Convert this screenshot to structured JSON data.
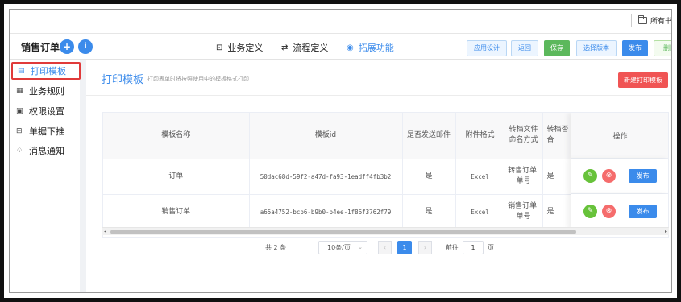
{
  "browser": {
    "bookmark_folder": "所有书签"
  },
  "header": {
    "app_title": "销售订单",
    "plus_icon": "+",
    "info_icon": "i",
    "tabs": [
      {
        "label": "业务定义",
        "icon": "form-icon"
      },
      {
        "label": "流程定义",
        "icon": "flow-icon"
      },
      {
        "label": "拓展功能",
        "icon": "extension-icon"
      }
    ],
    "buttons": {
      "app_design": "应用设计",
      "back": "返回",
      "save": "保存",
      "select_version": "选择版本",
      "publish": "发布",
      "delete": "删除"
    }
  },
  "sidebar": {
    "items": [
      {
        "label": "打印模板",
        "icon": "printer-icon"
      },
      {
        "label": "业务规则",
        "icon": "rules-icon"
      },
      {
        "label": "权限设置",
        "icon": "lock-icon"
      },
      {
        "label": "单据下推",
        "icon": "push-icon"
      },
      {
        "label": "消息通知",
        "icon": "bell-icon"
      }
    ]
  },
  "main": {
    "title": "打印模板",
    "description": "打印表单时将按照使用中的模板格式打印",
    "new_button": "新建打印模板"
  },
  "table": {
    "headers": [
      "模板名称",
      "模板id",
      "是否发送邮件",
      "附件格式",
      "转档文件命名方式",
      "转档否合",
      "操作"
    ],
    "rows": [
      {
        "name": "订单",
        "id": "50dac68d-59f2-a47d-fa93-1eadff4fb3b2",
        "send_email": "是",
        "format": "Excel",
        "naming": "转售订单.单号",
        "merge": "是",
        "publish": "发布"
      },
      {
        "name": "销售订单",
        "id": "a65a4752-bcb6-b9b0-b4ee-1f86f3762f79",
        "send_email": "是",
        "format": "Excel",
        "naming": "销售订单.单号",
        "merge": "是",
        "publish": "发布"
      }
    ]
  },
  "pagination": {
    "total": "共 2 条",
    "page_size": "10条/页",
    "current_page": "1",
    "goto_label": "前往",
    "goto_value": "1",
    "page_suffix": "页"
  },
  "colors": {
    "accent": "#3b8beb",
    "save_green": "#5cb85c",
    "danger_red": "#f05454",
    "highlight_border": "#e03a3a"
  }
}
